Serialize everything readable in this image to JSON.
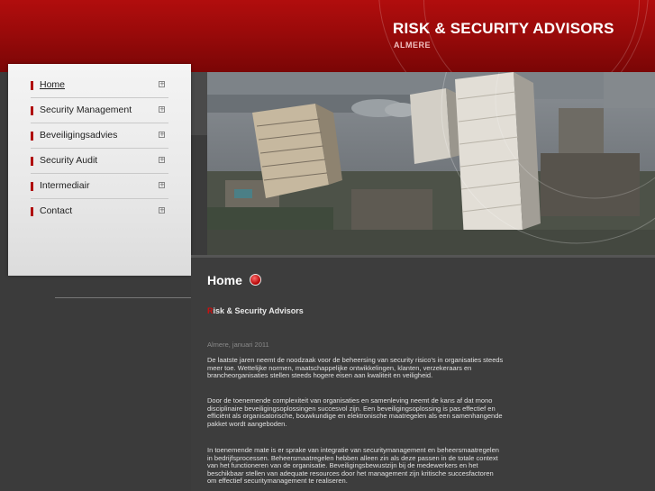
{
  "header": {
    "title": "RISK & SECURITY ADVISORS",
    "subtitle": "ALMERE"
  },
  "menu": {
    "items": [
      {
        "label": "Home",
        "active": true
      },
      {
        "label": "Security Management",
        "active": false
      },
      {
        "label": "Beveiligingsadvies",
        "active": false
      },
      {
        "label": "Security Audit",
        "active": false
      },
      {
        "label": "Intermediair",
        "active": false
      },
      {
        "label": "Contact",
        "active": false
      }
    ]
  },
  "content": {
    "heading": "Home",
    "subheading_first": "R",
    "subheading_rest": "isk & Security Advisors",
    "date": "Almere, januari 2011",
    "paragraphs": [
      "De laatste jaren neemt de noodzaak voor de beheersing van security risico's in organisaties steeds meer toe. Wettelijke normen, maatschappelijke ontwikkelingen, klanten, verzekeraars en brancheorganisaties stellen steeds hogere eisen aan kwaliteit en veiligheid.",
      "Door de toenemende complexiteit van organisaties en samenleving neemt de kans af dat mono disciplinaire beveiligingsoplossingen succesvol zijn. Een beveiligingsoplossing is pas effectief en efficiënt als organisatorische, bouwkundige en elektronische maatregelen als een samenhangende pakket wordt aangeboden.",
      "In toenemende mate is er sprake van integratie van securitymanagement en beheersmaatregelen in bedrijfsprocessen. Beheersmaatregelen hebben alleen zin als deze passen in de totale context van het functioneren van de organisatie. Beveiligingsbewustzijn bij de medewerkers en het beschikbaar stellen van adequate resources door het management zijn kritische succesfactoren om effectief securitymanagement te realiseren."
    ]
  },
  "colors": {
    "brand_red": "#b10d0d",
    "background": "#3a3a3a"
  },
  "icons": {
    "menu_expand": "plus-box-icon",
    "heading_bullet": "red-dot-icon"
  }
}
